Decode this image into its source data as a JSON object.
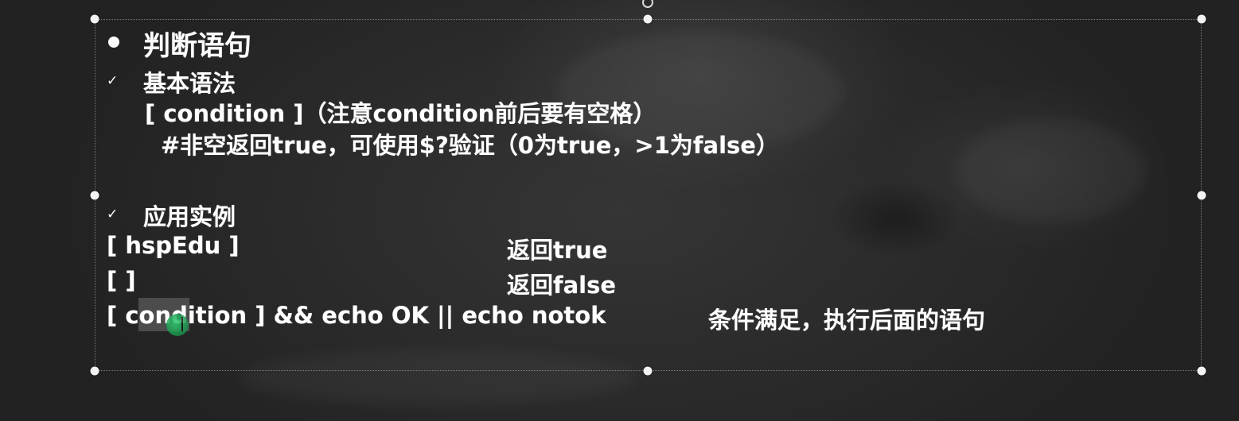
{
  "slide": {
    "title": "判断语句",
    "section_syntax": {
      "heading": "基本语法",
      "line1": "[ condition ]（注意condition前后要有空格）",
      "line2": "#非空返回true，可使用$?验证（0为true，>1为false）"
    },
    "section_examples": {
      "heading": "应用实例",
      "rows": [
        {
          "code": "[ hspEdu ]",
          "result": "返回true"
        },
        {
          "code": "[ ]",
          "result": "返回false"
        },
        {
          "code": "[ condition ] && echo OK || echo notok",
          "result": "条件满足，执行后面的语句"
        }
      ]
    }
  },
  "icons": {
    "bullet": "bullet-dot-icon",
    "check": "check-mark-icon",
    "cursor": "text-cursor-icon"
  },
  "colors": {
    "background": "#2a2a2a",
    "text": "#ffffff",
    "handle": "#f4f4f4",
    "cursor_accent": "#2ecc71"
  }
}
